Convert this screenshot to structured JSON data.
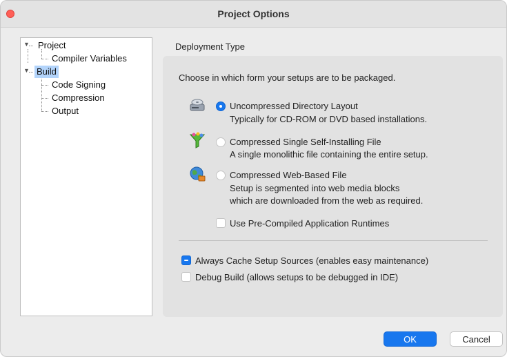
{
  "window": {
    "title": "Project Options"
  },
  "tree": {
    "items": [
      {
        "label": "Project",
        "expanded": true
      },
      {
        "label": "Compiler Variables"
      },
      {
        "label": "Build",
        "expanded": true,
        "selected": true
      },
      {
        "label": "Code Signing"
      },
      {
        "label": "Compression"
      },
      {
        "label": "Output"
      }
    ]
  },
  "deployment": {
    "section_label": "Deployment Type",
    "intro": "Choose in which form your setups are to be packaged.",
    "options": [
      {
        "title": "Uncompressed Directory Layout",
        "desc_lines": [
          "Typically for CD-ROM or DVD based installations."
        ],
        "selected": true,
        "icon": "disk-drive-icon"
      },
      {
        "title": "Compressed Single Self-Installing File",
        "desc_lines": [
          "A single monolithic file containing the entire setup."
        ],
        "selected": false,
        "icon": "funnel-icon"
      },
      {
        "title": "Compressed Web-Based File",
        "desc_lines": [
          "Setup is segmented into web media blocks",
          "which are downloaded from the web as required."
        ],
        "selected": false,
        "icon": "globe-icon"
      }
    ],
    "precompiled_runtimes": {
      "label": "Use Pre-Compiled Application Runtimes",
      "checked": false
    }
  },
  "settings": {
    "always_cache": {
      "label": "Always Cache Setup Sources (enables easy maintenance)",
      "checked": true
    },
    "debug_build": {
      "label": "Debug Build (allows setups to be debugged in IDE)",
      "checked": false
    }
  },
  "buttons": {
    "ok": "OK",
    "cancel": "Cancel"
  },
  "colors": {
    "accent": "#1877ee",
    "selection": "#b3d4fb",
    "close": "#ff5f57"
  }
}
